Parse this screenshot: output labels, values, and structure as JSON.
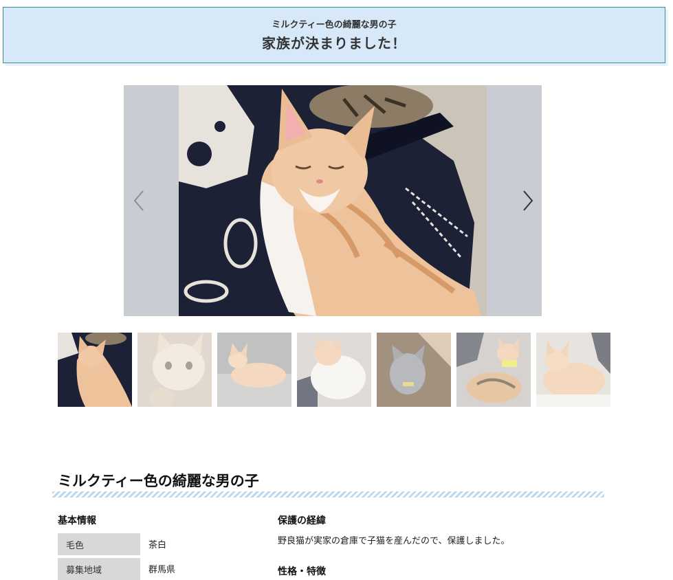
{
  "banner": {
    "subtitle": "ミルクティー色の綺麗な男の子",
    "title": "家族が決まりました！"
  },
  "slider": {
    "prev_icon": "chevron-left-icon",
    "next_icon": "chevron-right-icon",
    "bg_color": "#c9ccd2"
  },
  "thumbnails": [
    {
      "alt": "thumbnail-1",
      "active": true
    },
    {
      "alt": "thumbnail-2",
      "active": false
    },
    {
      "alt": "thumbnail-3",
      "active": false
    },
    {
      "alt": "thumbnail-4",
      "active": false
    },
    {
      "alt": "thumbnail-5",
      "active": false
    },
    {
      "alt": "thumbnail-6",
      "active": false
    },
    {
      "alt": "thumbnail-7",
      "active": false
    }
  ],
  "profile": {
    "name": "ミルクティー色の綺麗な男の子",
    "basic_info": {
      "heading": "基本情報",
      "rows": [
        {
          "label": "毛色",
          "value": "茶白"
        },
        {
          "label": "募集地域",
          "value": "群馬県"
        }
      ]
    },
    "rescue": {
      "heading": "保護の経緯",
      "text": "野良猫が実家の倉庫で子猫を産んだので、保護しました。"
    },
    "personality": {
      "heading": "性格・特徴"
    }
  },
  "colors": {
    "banner_bg": "#d7e8f8",
    "banner_border": "#3c8f8c",
    "stripe": "#bcd9f2"
  }
}
